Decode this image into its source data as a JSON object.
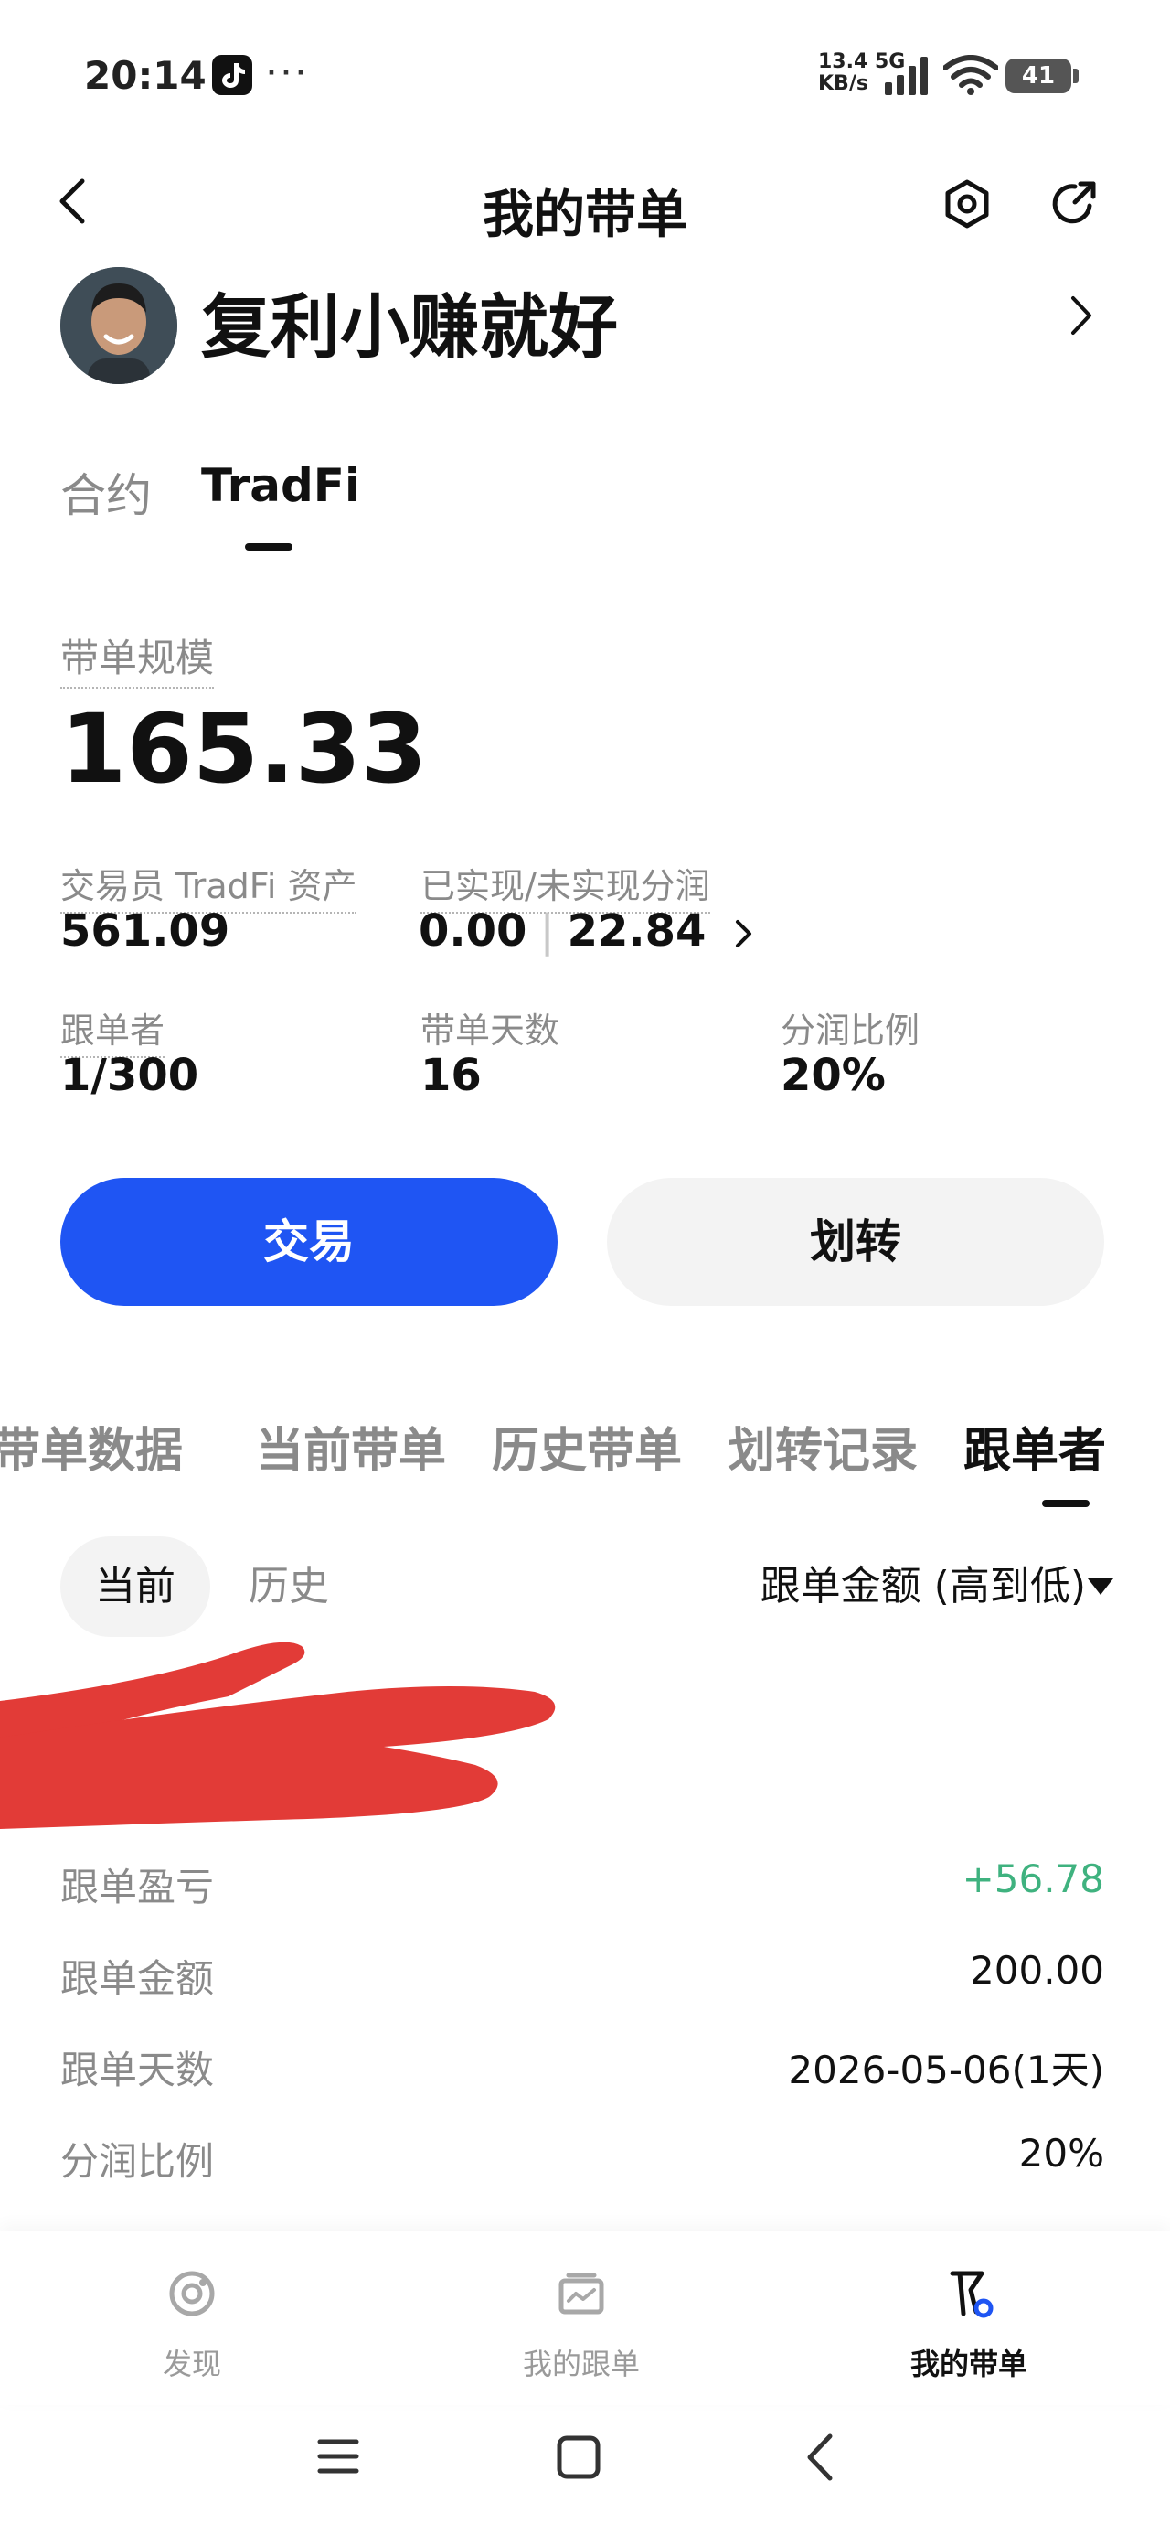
{
  "status_bar": {
    "time": "20:14",
    "dots": "···",
    "speed_line1": "13.4 5G",
    "speed_line2": "KB/s",
    "battery": "41"
  },
  "header": {
    "title": "我的带单"
  },
  "profile": {
    "name": "复利小赚就好"
  },
  "top_tabs": [
    "合约",
    "TradFi"
  ],
  "scale": {
    "label": "带单规模",
    "value": "165.33"
  },
  "stats": {
    "trader_assets_label": "交易员 TradFi 资产",
    "trader_assets_value": "561.09",
    "profit_share_label": "已实现/未实现分润",
    "realized": "0.00",
    "unrealized": "22.84",
    "followers_label": "跟单者",
    "followers_value": "1/300",
    "days_label": "带单天数",
    "days_value": "16",
    "ratio_label": "分润比例",
    "ratio_value": "20%"
  },
  "buttons": {
    "trade": "交易",
    "transfer": "划转"
  },
  "section_tabs": [
    "带单数据",
    "当前带单",
    "历史带单",
    "划转记录",
    "跟单者"
  ],
  "filters": {
    "current": "当前",
    "history": "历史",
    "sort": "跟单金额 (高到低)"
  },
  "follower_detail": [
    {
      "label": "跟单盈亏",
      "value": "+56.78"
    },
    {
      "label": "跟单金额",
      "value": "200.00"
    },
    {
      "label": "跟单天数",
      "value": "2026-05-06(1天)"
    },
    {
      "label": "分润比例",
      "value": "20%"
    }
  ],
  "bottom_nav": [
    {
      "label": "发现"
    },
    {
      "label": "我的跟单"
    },
    {
      "label": "我的带单"
    }
  ],
  "colors": {
    "accent_blue": "#1f55f3",
    "profit_green": "#3fb27f",
    "redaction_red": "#e23b37"
  }
}
